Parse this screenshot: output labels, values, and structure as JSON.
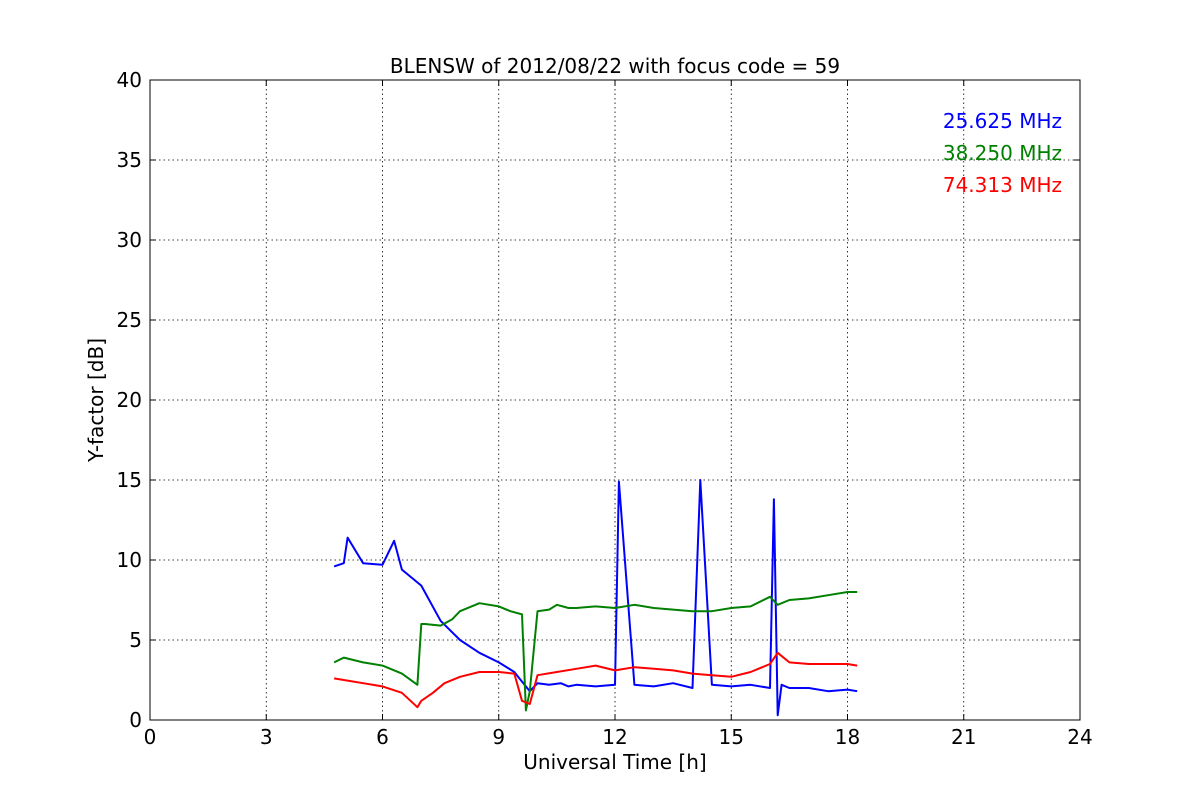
{
  "chart_data": {
    "type": "line",
    "title": "BLENSW of 2012/08/22 with focus code = 59",
    "xlabel": "Universal Time [h]",
    "ylabel": "Y-factor [dB]",
    "xlim": [
      0,
      24
    ],
    "ylim": [
      0,
      40
    ],
    "x_ticks": [
      0,
      3,
      6,
      9,
      12,
      15,
      18,
      21,
      24
    ],
    "y_ticks": [
      0,
      5,
      10,
      15,
      20,
      25,
      30,
      35,
      40
    ],
    "grid": true,
    "legend_position": "top-right",
    "series": [
      {
        "name": "25.625 MHz",
        "color": "#0000ff",
        "x": [
          4.75,
          5.0,
          5.1,
          5.5,
          6.0,
          6.3,
          6.5,
          7.0,
          7.5,
          8.0,
          8.5,
          9.0,
          9.4,
          9.6,
          9.8,
          10.0,
          10.3,
          10.6,
          10.8,
          11.0,
          11.5,
          12.0,
          12.1,
          12.5,
          13.0,
          13.5,
          14.0,
          14.2,
          14.5,
          15.0,
          15.5,
          16.0,
          16.1,
          16.2,
          16.3,
          16.5,
          17.0,
          17.5,
          18.0,
          18.25
        ],
        "y": [
          9.6,
          9.8,
          11.4,
          9.8,
          9.7,
          11.2,
          9.4,
          8.4,
          6.2,
          5.0,
          4.2,
          3.6,
          3.0,
          2.4,
          1.8,
          2.3,
          2.2,
          2.3,
          2.1,
          2.2,
          2.1,
          2.2,
          14.9,
          2.2,
          2.1,
          2.3,
          2.0,
          15.0,
          2.2,
          2.1,
          2.2,
          2.0,
          13.8,
          0.3,
          2.2,
          2.0,
          2.0,
          1.8,
          1.9,
          1.8
        ]
      },
      {
        "name": "38.250 MHz",
        "color": "#008000",
        "x": [
          4.75,
          5.0,
          5.5,
          6.0,
          6.5,
          6.9,
          7.0,
          7.1,
          7.5,
          7.8,
          8.0,
          8.5,
          9.0,
          9.3,
          9.6,
          9.7,
          9.8,
          10.0,
          10.3,
          10.5,
          10.8,
          11.0,
          11.5,
          12.0,
          12.5,
          13.0,
          13.5,
          14.0,
          14.5,
          15.0,
          15.5,
          16.0,
          16.2,
          16.5,
          17.0,
          17.5,
          18.0,
          18.25
        ],
        "y": [
          3.6,
          3.9,
          3.6,
          3.4,
          2.9,
          2.2,
          6.0,
          6.0,
          5.9,
          6.3,
          6.8,
          7.3,
          7.1,
          6.8,
          6.6,
          0.6,
          1.8,
          6.8,
          6.9,
          7.2,
          7.0,
          7.0,
          7.1,
          7.0,
          7.2,
          7.0,
          6.9,
          6.8,
          6.8,
          7.0,
          7.1,
          7.7,
          7.2,
          7.5,
          7.6,
          7.8,
          8.0,
          8.0
        ]
      },
      {
        "name": "74.313 MHz",
        "color": "#ff0000",
        "x": [
          4.75,
          5.0,
          5.5,
          6.0,
          6.5,
          6.9,
          7.0,
          7.3,
          7.6,
          8.0,
          8.5,
          9.0,
          9.4,
          9.6,
          9.8,
          10.0,
          10.5,
          11.0,
          11.5,
          12.0,
          12.5,
          13.0,
          13.5,
          14.0,
          14.5,
          15.0,
          15.5,
          16.0,
          16.2,
          16.5,
          17.0,
          17.5,
          18.0,
          18.25
        ],
        "y": [
          2.6,
          2.5,
          2.3,
          2.1,
          1.7,
          0.8,
          1.2,
          1.7,
          2.3,
          2.7,
          3.0,
          3.0,
          2.9,
          1.2,
          1.0,
          2.8,
          3.0,
          3.2,
          3.4,
          3.1,
          3.3,
          3.2,
          3.1,
          2.9,
          2.8,
          2.7,
          3.0,
          3.5,
          4.2,
          3.6,
          3.5,
          3.5,
          3.5,
          3.4
        ]
      }
    ]
  }
}
